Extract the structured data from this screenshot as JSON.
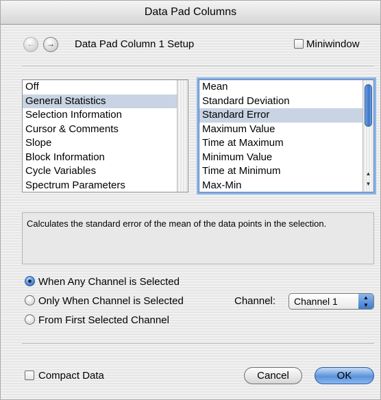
{
  "window": {
    "title": "Data Pad Columns"
  },
  "header": {
    "back_glyph": "←",
    "forward_glyph": "→",
    "setup_title": "Data Pad Column 1 Setup",
    "miniwindow_label": "Miniwindow",
    "miniwindow_checked": false
  },
  "categories": {
    "items": [
      "Off",
      "General Statistics",
      "Selection Information",
      "Cursor & Comments",
      "Slope",
      "Block Information",
      "Cycle Variables",
      "Spectrum Parameters"
    ],
    "selected_index": 1
  },
  "functions": {
    "items": [
      "Mean",
      "Standard Deviation",
      "Standard Error",
      "Maximum Value",
      "Time at Maximum",
      "Minimum Value",
      "Time at Minimum",
      "Max-Min"
    ],
    "selected_index": 2
  },
  "description": "Calculates the standard error of the mean of the data points in the selection.",
  "channel_options": {
    "options": [
      "When Any Channel is Selected",
      "Only When Channel is Selected",
      "From First Selected Channel"
    ],
    "selected_index": 0
  },
  "channel_select": {
    "label": "Channel:",
    "value": "Channel 1"
  },
  "footer": {
    "compact_label": "Compact Data",
    "compact_checked": false,
    "cancel_label": "Cancel",
    "ok_label": "OK"
  },
  "colors": {
    "selection": "#c8d4e3",
    "focus_ring": "#8cb4e6",
    "accent": "#3d74c8"
  },
  "icons": [
    "back-arrow-icon",
    "forward-arrow-icon",
    "scroll-up-arrow-icon",
    "scroll-down-arrow-icon",
    "popup-arrows-icon"
  ]
}
